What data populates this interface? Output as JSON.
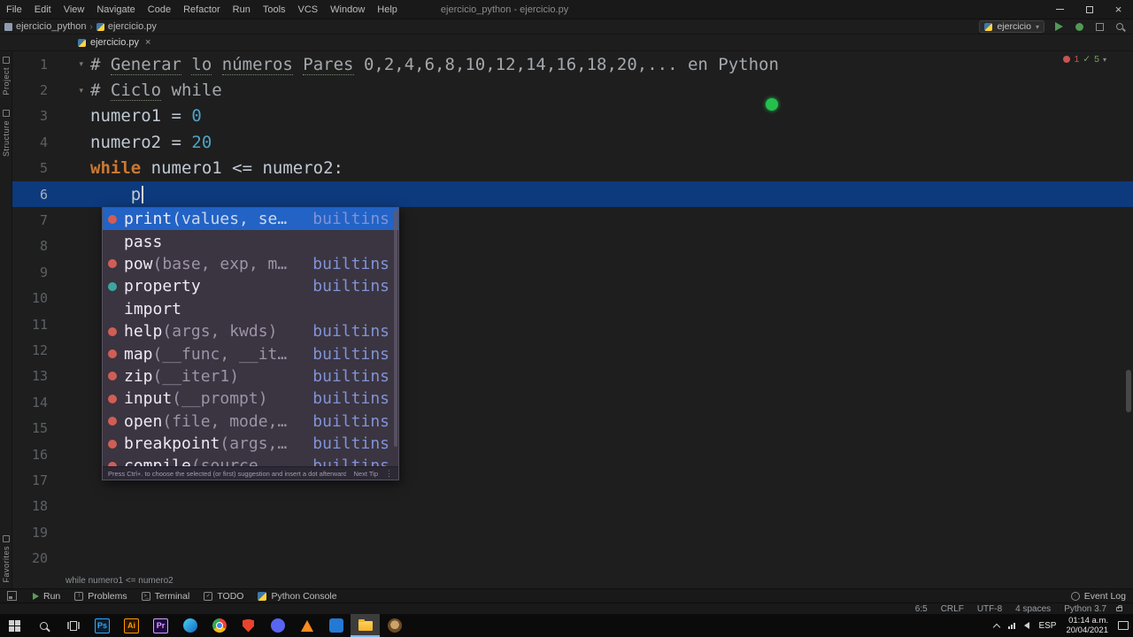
{
  "palette": {
    "selection_blue": "#2263c5",
    "caret_line_blue": "#0d3a7d",
    "keyword_orange": "#cc7832",
    "number_blue": "#4da3c7",
    "run_green": "#519955",
    "error_red": "#c75450",
    "builtins_lavender": "#8292d8",
    "recording_dot_green": "#25bf4e"
  },
  "title_bar": {
    "menus": [
      "File",
      "Edit",
      "View",
      "Navigate",
      "Code",
      "Refactor",
      "Run",
      "Tools",
      "VCS",
      "Window",
      "Help"
    ],
    "title": "ejercicio_python - ejercicio.py"
  },
  "nav_bar": {
    "breadcrumbs": [
      {
        "label": "ejercicio_python",
        "icon": "folder-icon"
      },
      {
        "label": "ejercicio.py",
        "icon": "python-file-icon"
      }
    ],
    "run_config": {
      "label": "ejercicio"
    }
  },
  "tab_bar": {
    "tabs": [
      {
        "label": "ejercicio.py",
        "active": true
      }
    ]
  },
  "tool_stripes": {
    "left_top": [
      "Project",
      "Structure"
    ],
    "left_bottom": [
      "Favorites"
    ]
  },
  "editor": {
    "inspection_widget": {
      "errors": "1",
      "ok": "5"
    },
    "context_breadcrumb": "while numero1 <= numero2",
    "caret": {
      "line": 6,
      "col": 5
    },
    "lines": [
      {
        "num": 1,
        "fold": true,
        "segments": [
          {
            "c": "comment",
            "t": "# "
          },
          {
            "c": "comment",
            "u": true,
            "t": "Generar"
          },
          {
            "c": "comment",
            "t": " "
          },
          {
            "c": "comment",
            "u": true,
            "t": "lo"
          },
          {
            "c": "comment",
            "t": " "
          },
          {
            "c": "comment",
            "u": true,
            "t": "números"
          },
          {
            "c": "comment",
            "t": " "
          },
          {
            "c": "comment",
            "u": true,
            "t": "Pares"
          },
          {
            "c": "comment",
            "t": " 0,2,4,6,8,10,12,14,16,18,20,... en Python"
          }
        ]
      },
      {
        "num": 2,
        "fold": true,
        "segments": [
          {
            "c": "comment",
            "t": "# "
          },
          {
            "c": "comment",
            "u": true,
            "t": "Ciclo"
          },
          {
            "c": "comment",
            "t": " while"
          }
        ]
      },
      {
        "num": 3,
        "segments": [
          {
            "c": "plain",
            "t": "numero1 = "
          },
          {
            "c": "num",
            "t": "0"
          }
        ]
      },
      {
        "num": 4,
        "segments": [
          {
            "c": "plain",
            "t": "numero2 = "
          },
          {
            "c": "num",
            "t": "20"
          }
        ]
      },
      {
        "num": 5,
        "segments": [
          {
            "c": "kw",
            "t": "while"
          },
          {
            "c": "plain",
            "t": " numero1 <= numero2:"
          }
        ]
      },
      {
        "num": 6,
        "caret": true,
        "segments": [
          {
            "c": "plain",
            "t": "    p"
          }
        ]
      },
      {
        "num": 7
      },
      {
        "num": 8
      },
      {
        "num": 9
      },
      {
        "num": 10
      },
      {
        "num": 11
      },
      {
        "num": 12
      },
      {
        "num": 13
      },
      {
        "num": 14
      },
      {
        "num": 15
      },
      {
        "num": 16
      },
      {
        "num": 17
      },
      {
        "num": 18
      },
      {
        "num": 19
      },
      {
        "num": 20
      }
    ]
  },
  "completion_popup": {
    "items": [
      {
        "icon": "function",
        "name": "print",
        "params": "(values, se…",
        "tail": "builtins",
        "selected": true
      },
      {
        "icon": "",
        "name": "pass",
        "params": "",
        "tail": ""
      },
      {
        "icon": "function",
        "name": "pow",
        "params": "(base, exp, m…",
        "tail": "builtins"
      },
      {
        "icon": "property",
        "name": "property",
        "params": "",
        "tail": "builtins"
      },
      {
        "icon": "",
        "name": "import",
        "params": "",
        "tail": ""
      },
      {
        "icon": "function",
        "name": "help",
        "params": "(args, kwds)",
        "tail": "builtins"
      },
      {
        "icon": "function",
        "name": "map",
        "params": "(__func, __it…",
        "tail": "builtins"
      },
      {
        "icon": "function",
        "name": "zip",
        "params": "(__iter1)",
        "tail": "builtins"
      },
      {
        "icon": "function",
        "name": "input",
        "params": "(__prompt)",
        "tail": "builtins"
      },
      {
        "icon": "function",
        "name": "open",
        "params": "(file, mode,…",
        "tail": "builtins"
      },
      {
        "icon": "function",
        "name": "breakpoint",
        "params": "(args,…",
        "tail": "builtins"
      },
      {
        "icon": "function",
        "name": "compile",
        "params": "(source…",
        "tail": "builtins"
      }
    ],
    "hint": "Press Ctrl+. to choose the selected (or first) suggestion and insert a dot afterwards",
    "hint_action": "Next Tip"
  },
  "tool_window_bar": {
    "left": [
      {
        "label": "Run",
        "icon": "play-icon"
      },
      {
        "label": "Problems",
        "icon": "problems-icon"
      },
      {
        "label": "Terminal",
        "icon": "terminal-icon"
      },
      {
        "label": "TODO",
        "icon": "todo-icon"
      },
      {
        "label": "Python Console",
        "icon": "python-console-icon"
      }
    ],
    "right": [
      {
        "label": "Event Log",
        "icon": "event-log-icon"
      }
    ]
  },
  "status_bar": {
    "items": [
      "6:5",
      "CRLF",
      "UTF-8",
      "4 spaces",
      "Python 3.7"
    ]
  },
  "taskbar": {
    "lang": "ESP",
    "time": "01:14 a.m.",
    "date": "20/04/2021",
    "icons": [
      {
        "name": "start-button",
        "kind": "win"
      },
      {
        "name": "search-button",
        "kind": "search"
      },
      {
        "name": "task-view-button",
        "kind": "taskview"
      },
      {
        "name": "photoshop-icon",
        "kind": "badge",
        "text": "Ps",
        "bg": "#0a1e2d",
        "fg": "#31a8ff"
      },
      {
        "name": "illustrator-icon",
        "kind": "badge",
        "text": "Ai",
        "bg": "#2b1600",
        "fg": "#ff9a00"
      },
      {
        "name": "premiere-icon",
        "kind": "badge",
        "text": "Pr",
        "bg": "#1f0740",
        "fg": "#d8a1ff"
      },
      {
        "name": "edge-icon",
        "kind": "circle",
        "bg": "linear-gradient(135deg,#45d4f5,#1565c0)"
      },
      {
        "name": "chrome-icon",
        "kind": "chrome"
      },
      {
        "name": "shield-app-icon",
        "kind": "shield"
      },
      {
        "name": "discord-icon",
        "kind": "circle",
        "bg": "#5865f2"
      },
      {
        "name": "vlc-icon",
        "kind": "cone"
      },
      {
        "name": "photos-icon",
        "kind": "square",
        "bg": "#2479d4"
      },
      {
        "name": "file-explorer-icon",
        "kind": "folder",
        "active": true
      },
      {
        "name": "clock-app-icon",
        "kind": "circle",
        "bg": "radial-gradient(circle at 50% 45%,#caa36a 40%,#6d4a26 42%)"
      }
    ]
  }
}
